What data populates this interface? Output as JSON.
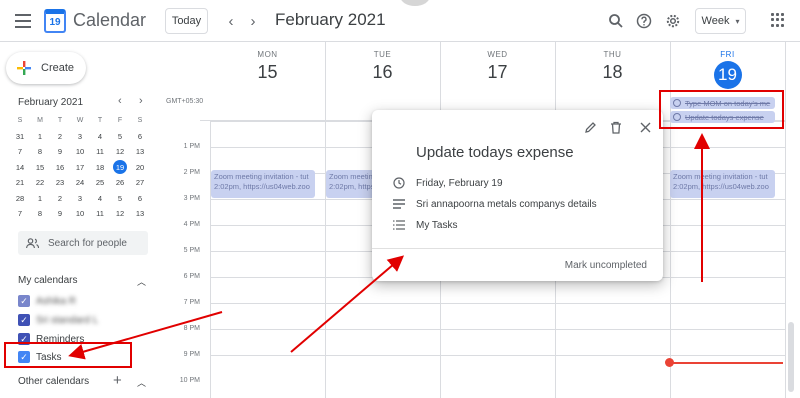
{
  "header": {
    "app_title": "Calendar",
    "logo_day": "19",
    "today_label": "Today",
    "prev_label": "‹",
    "next_label": "›",
    "month_title": "February 2021",
    "view_label": "Week",
    "view_caret": "▾"
  },
  "sidebar": {
    "create_label": "Create",
    "mini_calendar": {
      "title": "February 2021",
      "prev": "‹",
      "next": "›",
      "weekdays": [
        "S",
        "M",
        "T",
        "W",
        "T",
        "F",
        "S"
      ],
      "weeks": [
        [
          "31",
          "1",
          "2",
          "3",
          "4",
          "5",
          "6"
        ],
        [
          "7",
          "8",
          "9",
          "10",
          "11",
          "12",
          "13"
        ],
        [
          "14",
          "15",
          "16",
          "17",
          "18",
          "19",
          "20"
        ],
        [
          "21",
          "22",
          "23",
          "24",
          "25",
          "26",
          "27"
        ],
        [
          "28",
          "1",
          "2",
          "3",
          "4",
          "5",
          "6"
        ],
        [
          "7",
          "8",
          "9",
          "10",
          "11",
          "12",
          "13"
        ]
      ],
      "selected_day": "19"
    },
    "search_people_placeholder": "Search for people",
    "my_calendars_title": "My calendars",
    "my_calendars": [
      {
        "label": "Ashika R",
        "color": "#7986cb",
        "checked": true,
        "blurred": true
      },
      {
        "label": "Sri standard L",
        "color": "#3f51b5",
        "checked": true,
        "blurred": true
      },
      {
        "label": "Reminders",
        "color": "#3f51b5",
        "checked": true,
        "blurred": false
      },
      {
        "label": "Tasks",
        "color": "#4285f4",
        "checked": true,
        "blurred": false
      }
    ],
    "other_calendars_title": "Other calendars"
  },
  "week": {
    "timezone": "GMT+05:30",
    "days": [
      {
        "dow": "MON",
        "num": "15"
      },
      {
        "dow": "TUE",
        "num": "16"
      },
      {
        "dow": "WED",
        "num": "17"
      },
      {
        "dow": "THU",
        "num": "18"
      },
      {
        "dow": "FRI",
        "num": "19"
      }
    ],
    "today_index": 4,
    "hours": [
      "1 PM",
      "2 PM",
      "3 PM",
      "4 PM",
      "5 PM",
      "6 PM",
      "7 PM",
      "8 PM",
      "9 PM",
      "10 PM"
    ]
  },
  "events": [
    {
      "title": "Zoom meeting invitation - tut",
      "detail": "2:02pm, https://us04web.zoo"
    },
    {
      "title": "Zoom meeting invitation - tut",
      "detail": "2:02pm, https://us04web.zoo"
    },
    {
      "title": "Zoom meeting invitation - tut",
      "detail": "2:02pm, https://us04web.zoo"
    }
  ],
  "tasks": [
    {
      "title": "Type MOM on today's me"
    },
    {
      "title": "Update todays expense"
    }
  ],
  "popup": {
    "title": "Update todays expense",
    "date": "Friday, February 19",
    "description": "Sri annapoorna metals companys details",
    "list": "My Tasks",
    "action": "Mark uncompleted"
  },
  "annotation_color": "#e10000",
  "accent_color": "#1a73e8"
}
